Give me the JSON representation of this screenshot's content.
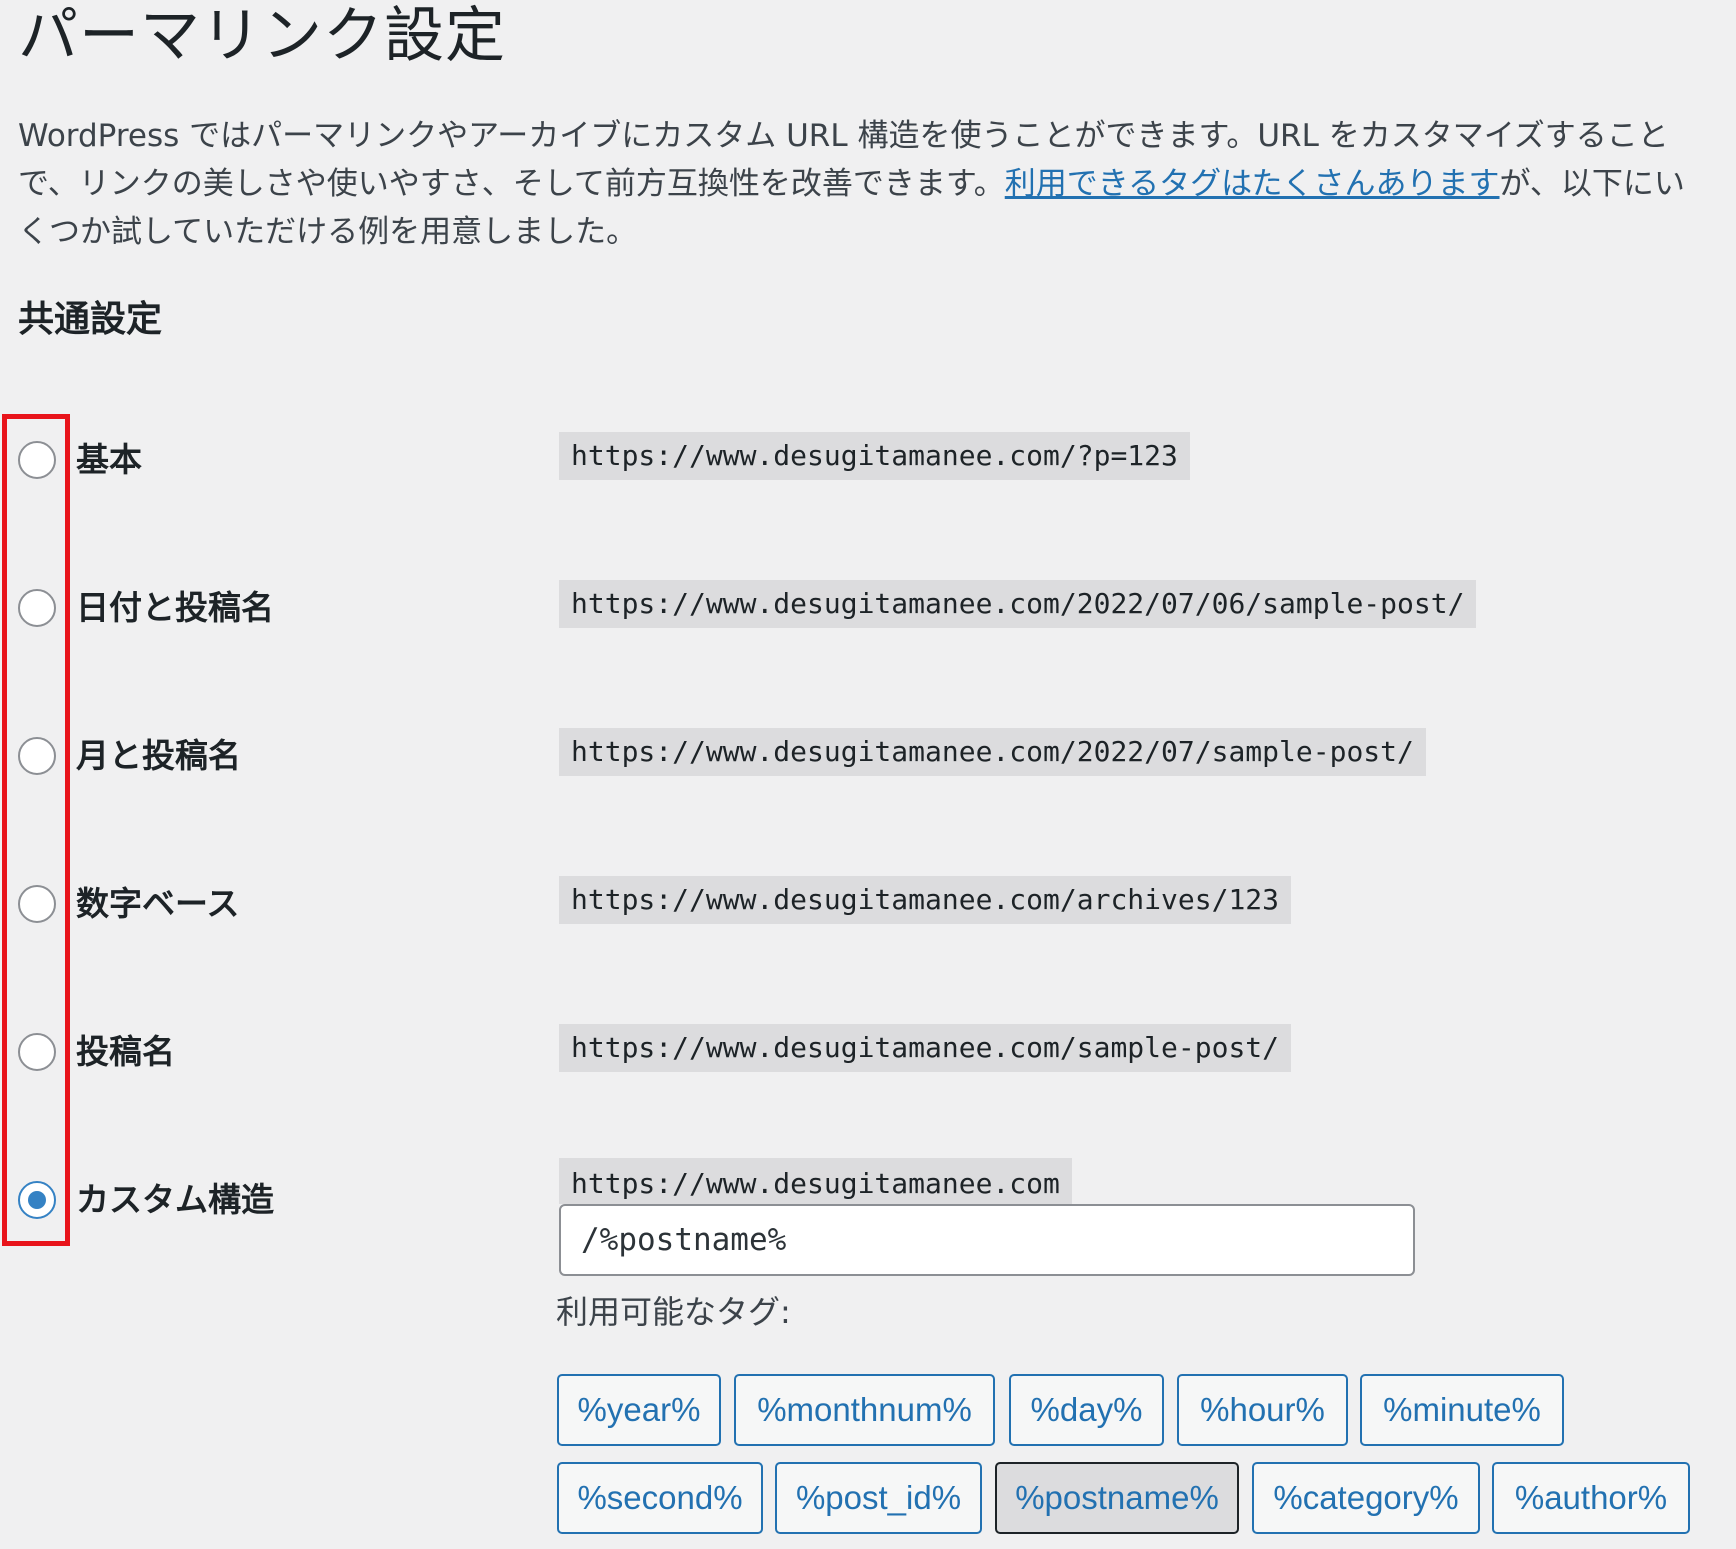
{
  "page": {
    "title": "パーマリンク設定",
    "intro_line1": "WordPress ではパーマリンクやアーカイブにカスタム URL 構造を使うことができます。URL をカスタマイズすること",
    "intro_line2_before": "で、リンクの美しさや使いやすさ、そして前方互換性を改善できます。",
    "intro_link": "利用できるタグはたくさんあります",
    "intro_line2_after": "が、以下にい",
    "intro_line3": "くつか試していただける例を用意しました。"
  },
  "common_settings": {
    "heading": "共通設定",
    "options": [
      {
        "label": "基本",
        "example": "https://www.desugitamanee.com/?p=123",
        "checked": false
      },
      {
        "label": "日付と投稿名",
        "example": "https://www.desugitamanee.com/2022/07/06/sample-post/",
        "checked": false
      },
      {
        "label": "月と投稿名",
        "example": "https://www.desugitamanee.com/2022/07/sample-post/",
        "checked": false
      },
      {
        "label": "数字ベース",
        "example": "https://www.desugitamanee.com/archives/123",
        "checked": false
      },
      {
        "label": "投稿名",
        "example": "https://www.desugitamanee.com/sample-post/",
        "checked": false
      },
      {
        "label": "カスタム構造",
        "example": "https://www.desugitamanee.com",
        "checked": true
      }
    ],
    "custom_structure_value": "/%postname%",
    "available_tags_label": "利用可能なタグ:",
    "tags": [
      "%year%",
      "%monthnum%",
      "%day%",
      "%hour%",
      "%minute%",
      "%second%",
      "%post_id%",
      "%postname%",
      "%category%",
      "%author%"
    ],
    "active_tag": "%postname%"
  },
  "colors": {
    "highlight_border": "#e8141b",
    "link": "#2271b1",
    "radio_checked": "#3582c4"
  }
}
